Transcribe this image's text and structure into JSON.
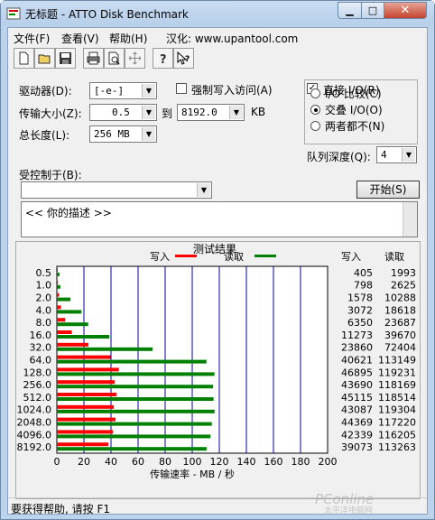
{
  "window": {
    "title": "无标题 - ATTO Disk Benchmark"
  },
  "menu": {
    "file": "文件(F)",
    "view": "查看(V)",
    "help": "帮助(H)",
    "localized": "汉化: www.upantool.com"
  },
  "toolbar": {
    "icons": [
      "new-icon",
      "open-icon",
      "save-icon",
      "print-icon",
      "print-preview-icon",
      "move-icon",
      "help-icon",
      "context-help-icon"
    ]
  },
  "settings": {
    "drive_label": "驱动器(D):",
    "drive_value": "[-e-]",
    "transfer_label": "传输大小(Z):",
    "transfer_from": "0.5",
    "transfer_to_label": "到",
    "transfer_to": "8192.0",
    "transfer_unit": "KB",
    "length_label": "总长度(L):",
    "length_value": "256 MB",
    "force_write_label": "强制写入访问(A)",
    "force_write_checked": false,
    "direct_io_label": "直接 I/O(R)",
    "direct_io_checked": true,
    "io_compare_label": "I/O 比较(C)",
    "overlapped_label": "交叠 I/O(O)",
    "neither_label": "两者都不(N)",
    "selected_mode": "overlapped",
    "queue_label": "队列深度(Q):",
    "queue_value": "4",
    "controlled_label": "受控制于(B):",
    "controlled_value": "",
    "start_label": "开始(S)"
  },
  "description": {
    "text": "<<  你的描述   >>"
  },
  "results": {
    "title": "测试结果",
    "write_legend": "写入",
    "read_legend": "读取",
    "write_col": "写入",
    "read_col": "读取",
    "write_color": "#ff0000",
    "read_color": "#008000"
  },
  "chart_data": {
    "type": "bar",
    "orientation": "horizontal",
    "categories": [
      "0.5",
      "1.0",
      "2.0",
      "4.0",
      "8.0",
      "16.0",
      "32.0",
      "64.0",
      "128.0",
      "256.0",
      "512.0",
      "1024.0",
      "2048.0",
      "4096.0",
      "8192.0"
    ],
    "series": [
      {
        "name": "写入",
        "color": "#ff0000",
        "values": [
          405,
          798,
          1578,
          3072,
          6350,
          11273,
          23860,
          40621,
          46895,
          43690,
          45115,
          43087,
          44369,
          42339,
          39073
        ]
      },
      {
        "name": "读取",
        "color": "#008000",
        "values": [
          1993,
          2625,
          10288,
          18618,
          23687,
          39670,
          72404,
          113149,
          119231,
          118169,
          118514,
          119304,
          117220,
          116205,
          113263
        ]
      }
    ],
    "x_ticks": [
      "0",
      "20",
      "40",
      "60",
      "80",
      "100",
      "120",
      "140",
      "160",
      "180",
      "200"
    ],
    "xlim": [
      0,
      200
    ],
    "xlabel": "传输速率 - MB / 秒",
    "grid": true,
    "legend": "top"
  },
  "status": {
    "text": "要获得帮助, 请按 F1"
  },
  "watermark": {
    "main": "PConline",
    "sub": "太平洋电脑网"
  }
}
